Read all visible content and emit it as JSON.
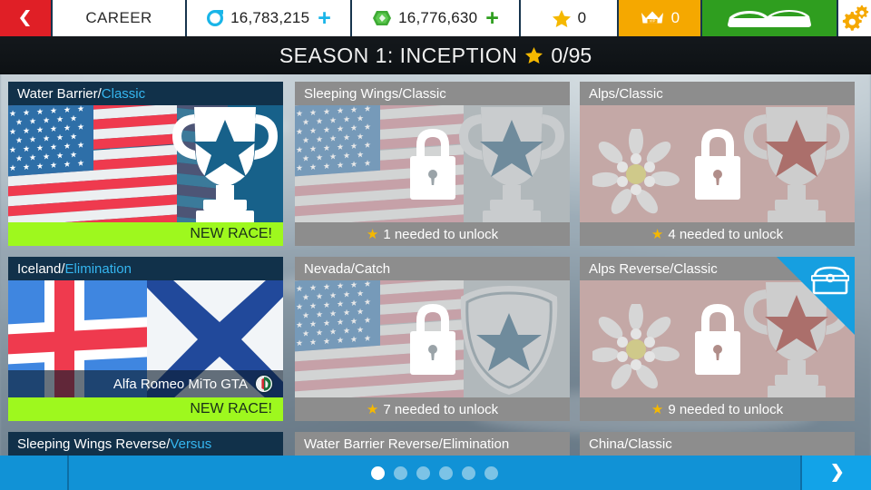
{
  "header": {
    "back_icon": "chevron-left-icon",
    "career_label": "CAREER",
    "coins": {
      "icon": "coin-icon",
      "value": "16,783,215",
      "plus": "+"
    },
    "bucks": {
      "icon": "bucks-icon",
      "value": "16,776,630",
      "plus": "+"
    },
    "stars": {
      "icon": "star-icon",
      "value": "0"
    },
    "vip": {
      "icon": "vip-crown-icon",
      "value": "0"
    },
    "garage": {
      "icon": "cars-icon"
    },
    "settings": {
      "icon": "gear-icon"
    }
  },
  "season": {
    "title": "SEASON 1: INCEPTION",
    "star_icon": "star-icon",
    "progress": "0/95"
  },
  "cards": [
    {
      "location": "Water Barrier",
      "separator": "/",
      "type": "Classic",
      "state": "unlocked",
      "footer": "NEW RACE!",
      "art": "usa-trophy",
      "lock_icon": "",
      "ribbon": "",
      "car": ""
    },
    {
      "location": "Sleeping Wings",
      "separator": "/",
      "type": "Classic",
      "state": "locked",
      "footer": "1 needed to unlock",
      "art": "usa-trophy",
      "lock_icon": "padlock-icon",
      "ribbon": "",
      "car": ""
    },
    {
      "location": "Alps",
      "separator": "/",
      "type": "Classic",
      "state": "locked",
      "footer": "4 needed to unlock",
      "art": "alps-trophy",
      "lock_icon": "padlock-icon",
      "ribbon": "",
      "car": ""
    },
    {
      "location": "Iceland",
      "separator": "/",
      "type": "Elimination",
      "state": "unlocked",
      "footer": "NEW RACE!",
      "art": "iceland",
      "lock_icon": "",
      "ribbon": "",
      "car": "Alfa Romeo MiTo GTA",
      "car_badge": "alfa-romeo-badge-icon"
    },
    {
      "location": "Nevada",
      "separator": "/",
      "type": "Catch",
      "state": "locked",
      "footer": "7 needed to unlock",
      "art": "usa-shield",
      "lock_icon": "padlock-icon",
      "ribbon": "",
      "car": ""
    },
    {
      "location": "Alps Reverse",
      "separator": "/",
      "type": "Classic",
      "state": "locked",
      "footer": "9 needed to unlock",
      "art": "alps-trophy",
      "lock_icon": "padlock-icon",
      "ribbon": "treasure-chest-icon",
      "car": ""
    },
    {
      "location": "Sleeping Wings Reverse",
      "separator": "/",
      "type": "Versus",
      "state": "unlocked",
      "footer": "",
      "art": "",
      "lock_icon": "",
      "ribbon": "",
      "car": ""
    },
    {
      "location": "Water Barrier Reverse",
      "separator": "/",
      "type": "Elimination",
      "state": "locked",
      "footer": "",
      "art": "",
      "lock_icon": "",
      "ribbon": "",
      "car": ""
    },
    {
      "location": "China",
      "separator": "/",
      "type": "Classic",
      "state": "locked",
      "footer": "",
      "art": "",
      "lock_icon": "",
      "ribbon": "",
      "car": ""
    }
  ],
  "pagination": {
    "total": 6,
    "active_index": 0,
    "next_icon": "chevron-right-icon"
  },
  "colors": {
    "accent_blue": "#35b6f0",
    "new_race_green": "#9ef81e",
    "card_header_dark": "#11314a",
    "card_header_locked": "#8d8d8d",
    "back_red": "#e01f26",
    "vip_orange": "#f5a800",
    "garage_green": "#2f9e1f",
    "bottom_blue": "#1192d6",
    "star_gold": "#f5b800"
  }
}
